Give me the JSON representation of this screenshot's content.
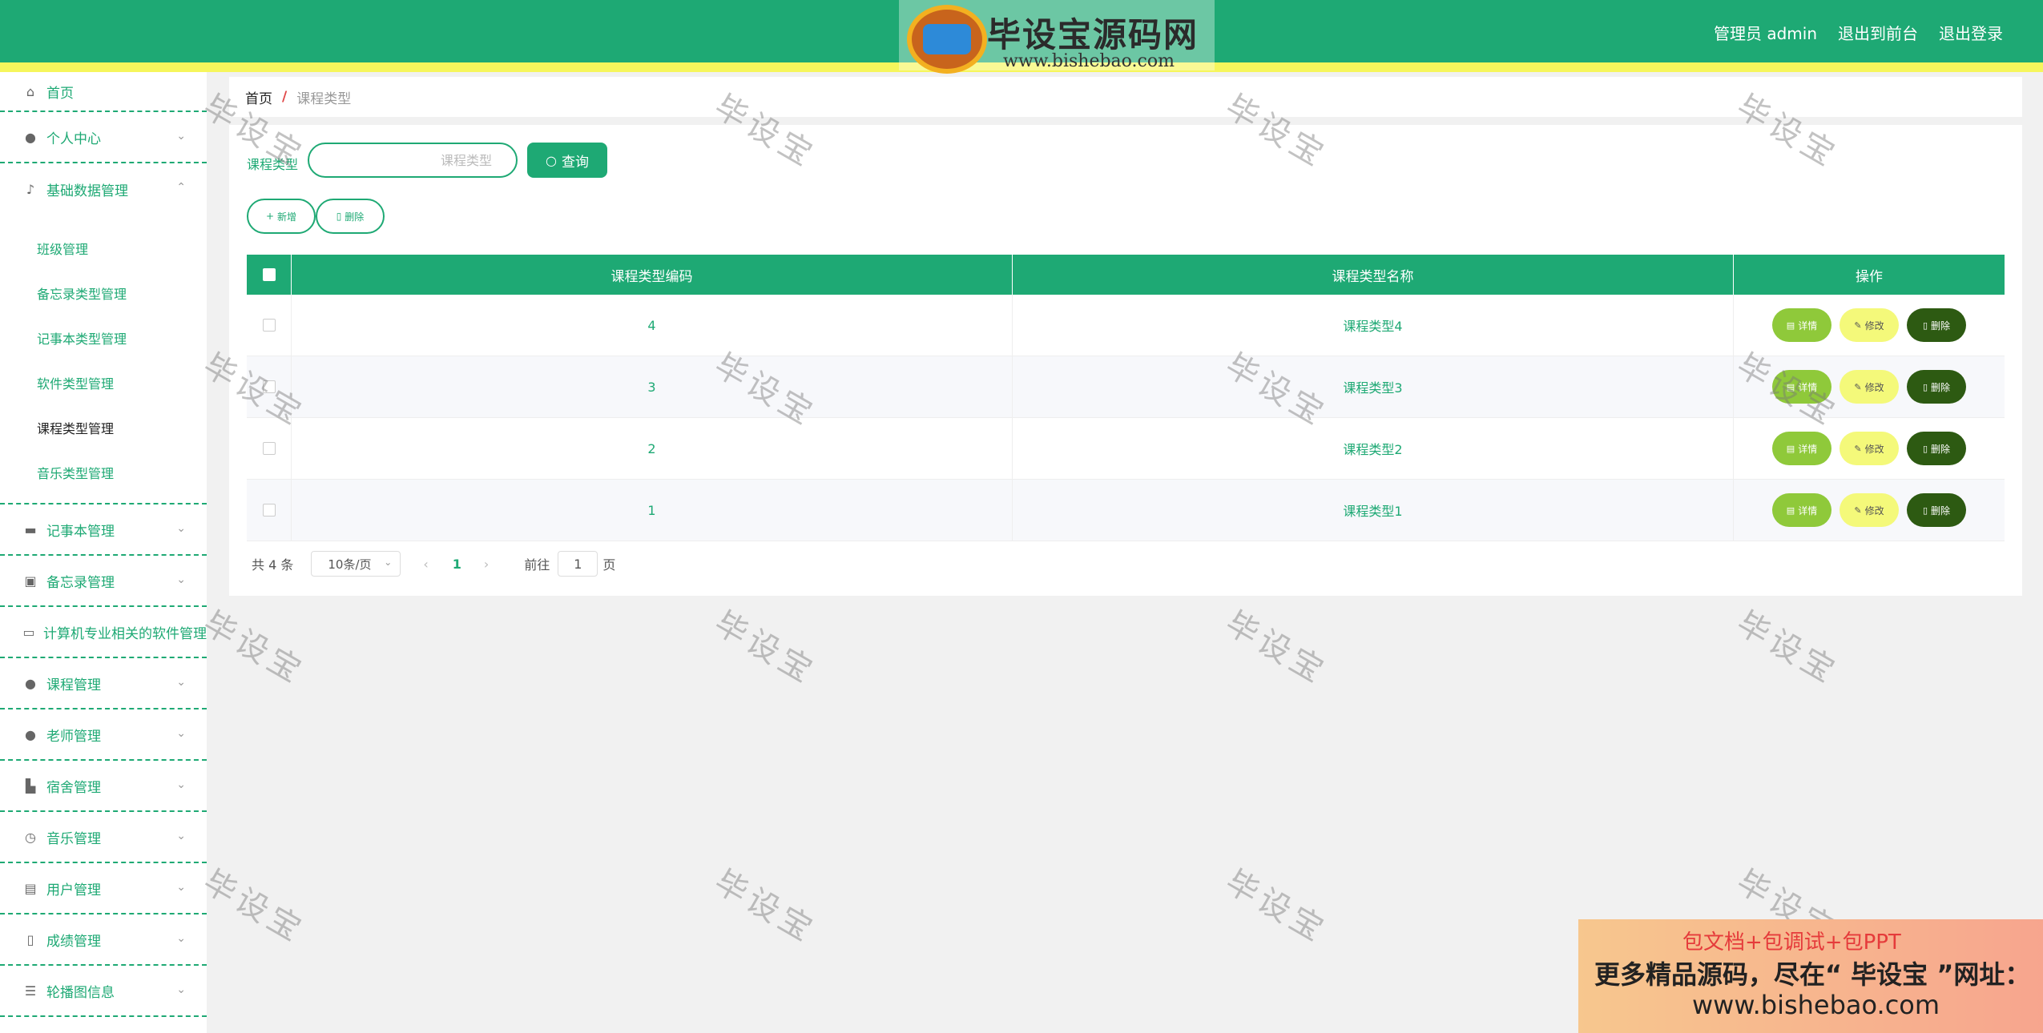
{
  "brand": {
    "title": "毕设宝源码网",
    "url": "www.bishebao.com"
  },
  "header": {
    "user": "管理员 admin",
    "to_front": "退出到前台",
    "logout": "退出登录"
  },
  "sidebar": {
    "home": "首页",
    "personal": "个人中心",
    "basic": "基础数据管理",
    "sub": [
      "班级管理",
      "备忘录类型管理",
      "记事本类型管理",
      "软件类型管理",
      "课程类型管理",
      "音乐类型管理"
    ],
    "items": [
      "记事本管理",
      "备忘录管理",
      "计算机专业相关的软件管理",
      "课程管理",
      "老师管理",
      "宿舍管理",
      "音乐管理",
      "用户管理",
      "成绩管理",
      "轮播图信息"
    ]
  },
  "breadcrumb": {
    "home": "首页",
    "sep": "/",
    "current": "课程类型"
  },
  "search": {
    "label": "课程类型",
    "placeholder": "课程类型",
    "button": "查询"
  },
  "actions": {
    "add": "新增",
    "delete": "删除"
  },
  "table": {
    "columns": [
      "课程类型编码",
      "课程类型名称",
      "操作"
    ],
    "rows": [
      {
        "code": "4",
        "name": "课程类型4"
      },
      {
        "code": "3",
        "name": "课程类型3"
      },
      {
        "code": "2",
        "name": "课程类型2"
      },
      {
        "code": "1",
        "name": "课程类型1"
      }
    ],
    "ops": {
      "detail": "详情",
      "edit": "修改",
      "delete": "删除"
    }
  },
  "pager": {
    "total": "共 4 条",
    "size": "10条/页",
    "current": "1",
    "goto": "前往",
    "goto_value": "1",
    "unit": "页"
  },
  "watermark": "毕设宝",
  "ad": {
    "line1": "包文档+包调试+包PPT",
    "line2": "更多精品源码，尽在“ 毕设宝 ”网址：",
    "line3": "www.bishebao.com"
  },
  "colors": {
    "primary": "#1ea974",
    "stripe": "#f6f65c",
    "detail": "#8fc93a",
    "edit": "#f4f97a",
    "del": "#2d5a12"
  }
}
